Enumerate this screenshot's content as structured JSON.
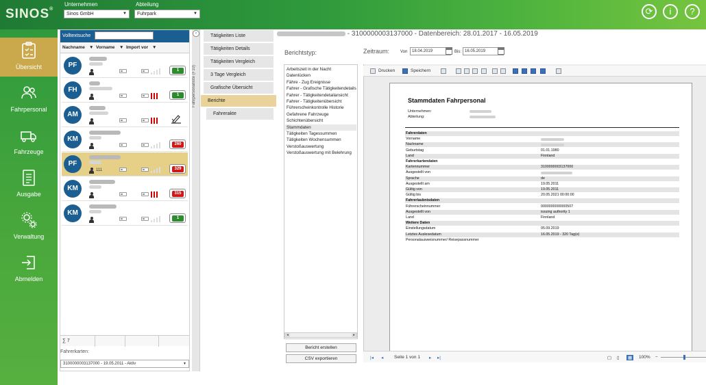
{
  "app": {
    "logo": "SINOS",
    "logo_mark": "®"
  },
  "header": {
    "company_label": "Unternehmen",
    "company_value": "Sinos GmbH",
    "department_label": "Abteilung",
    "department_value": "Fuhrpark",
    "icons": [
      "sync-icon",
      "info-icon",
      "help-icon"
    ],
    "info_glyph": "i",
    "help_glyph": "?",
    "sync_glyph": "⟳"
  },
  "sidenav": {
    "items": [
      {
        "label": "Übersicht",
        "icon": "checklist-icon",
        "active": true
      },
      {
        "label": "Fahrpersonal",
        "icon": "people-icon",
        "active": false
      },
      {
        "label": "Fahrzeuge",
        "icon": "truck-icon",
        "active": false
      },
      {
        "label": "Ausgabe",
        "icon": "document-icon",
        "active": false
      },
      {
        "label": "Verwaltung",
        "icon": "gears-icon",
        "active": false
      },
      {
        "label": "Abmelden",
        "icon": "logout-icon",
        "active": false
      }
    ]
  },
  "driver_list": {
    "search_label": "Volltextsuche",
    "columns": [
      "Nachname",
      "Vorname",
      "Import vor"
    ],
    "filter_glyph": "▼",
    "rows": [
      {
        "initials": "PF",
        "extra": "",
        "selected": false,
        "badge": "1",
        "badge_color": "#2e8b2e",
        "red_bars": false,
        "signature": false
      },
      {
        "initials": "FH",
        "extra": "",
        "selected": false,
        "badge": "1",
        "badge_color": "#2e8b2e",
        "red_bars": true,
        "signature": false
      },
      {
        "initials": "AM",
        "extra": "",
        "selected": false,
        "badge": "",
        "badge_color": "",
        "red_bars": true,
        "signature": true
      },
      {
        "initials": "KM",
        "extra": "",
        "selected": false,
        "badge": "260",
        "badge_color": "#d01818",
        "red_bars": false,
        "signature": false
      },
      {
        "initials": "PF",
        "extra": "111",
        "selected": true,
        "badge": "329",
        "badge_color": "#d01818",
        "red_bars": false,
        "signature": false
      },
      {
        "initials": "KM",
        "extra": "",
        "selected": false,
        "badge": "315",
        "badge_color": "#d01818",
        "red_bars": true,
        "signature": false
      },
      {
        "initials": "KM",
        "extra": "",
        "selected": false,
        "badge": "1",
        "badge_color": "#2e8b2e",
        "red_bars": false,
        "signature": false
      }
    ],
    "footer_sum": "∑ 7",
    "driver_cards_label": "Fahrerkarten:",
    "driver_cards_value": "3100000003137000 - 19.05.2011 - Aktiv"
  },
  "vertical_tab": {
    "label": "Fahrpersonalliste (F10)",
    "collapse_glyph": "‹"
  },
  "menu": {
    "items": [
      {
        "label": "Tätigkeiten Liste",
        "level": "sub"
      },
      {
        "label": "Tätigkeiten Details",
        "level": "sub"
      },
      {
        "label": "Tätigkeiten Vergleich",
        "level": "sub"
      },
      {
        "label": "3 Tage Vergleich",
        "level": "sub"
      },
      {
        "label": "Grafische Übersicht",
        "level": "sub"
      },
      {
        "label": "Berichte",
        "level": "top"
      },
      {
        "label": "Fahrerakte",
        "level": "sub"
      }
    ]
  },
  "content": {
    "title_suffix": "3100000003137000 - Datenbereich: 28.01.2017 - 16.05.2019",
    "report_type_label": "Berichtstyp:",
    "period_label": "Zeitraum:",
    "from_label": "Von",
    "from_value": "18.04.2019",
    "to_label": "Bis:",
    "to_value": "16.05.2019",
    "report_types": [
      "Arbeitszeit in der Nacht",
      "Datenlücken",
      "Fähre - Zug Ereignisse",
      "Fahrer - Grafische Tätigkeitendetails",
      "Fahrer - Tätigkeitendetailansicht",
      "Fahrer - Tätigkeitenübersicht",
      "Führerscheinkontrolle Historie",
      "Gefahrene Fahrzeuge",
      "Schichtenübersicht",
      "Stammdaten",
      "Tätigkeiten Tagessummen",
      "Tätigkeiten Wochensummen",
      "Verstoßauswertung",
      "Verstoßauswertung mit Belehrung"
    ],
    "selected_report_index": 9,
    "create_report_button": "Bericht erstellen",
    "csv_export_button": "CSV exportieren"
  },
  "viewer": {
    "print_label": "Drucken",
    "save_label": "Speichern",
    "page_status": "Seite 1 von 1",
    "zoom": "100%",
    "report": {
      "title": "Stammdaten Fahrpersonal",
      "company_label": "Unternehmen:",
      "department_label": "Abteilung:",
      "rows": [
        {
          "k": "Fahrerdaten",
          "v": "",
          "section": true,
          "blur": false
        },
        {
          "k": "Vorname",
          "v": "",
          "section": false,
          "blur": true
        },
        {
          "k": "Nachname",
          "v": "",
          "section": false,
          "blur": true
        },
        {
          "k": "Geburtstag",
          "v": "01.01.1980",
          "section": false,
          "blur": false
        },
        {
          "k": "Land",
          "v": "Finnland",
          "section": false,
          "blur": false
        },
        {
          "k": "Fahrerkartendaten",
          "v": "",
          "section": true,
          "blur": false
        },
        {
          "k": "Kartennummer",
          "v": "3100000003137000",
          "section": false,
          "blur": false
        },
        {
          "k": "Ausgestellt von",
          "v": "",
          "section": false,
          "blur": true
        },
        {
          "k": "Sprache",
          "v": "de",
          "section": false,
          "blur": false
        },
        {
          "k": "Ausgestellt am",
          "v": "19.05.2011",
          "section": false,
          "blur": false
        },
        {
          "k": "Gültig von",
          "v": "19.05.2011",
          "section": false,
          "blur": false
        },
        {
          "k": "Gültig bis",
          "v": "20.05.2021 00:00:00",
          "section": false,
          "blur": false
        },
        {
          "k": "Fahrerlaubnisdaten",
          "v": "",
          "section": true,
          "blur": false
        },
        {
          "k": "Führerscheinnummer",
          "v": "0000000000000507",
          "section": false,
          "blur": false
        },
        {
          "k": "Ausgestellt von",
          "v": "issuing authority 1",
          "section": false,
          "blur": false
        },
        {
          "k": "Land",
          "v": "Finnland",
          "section": false,
          "blur": false
        },
        {
          "k": "Weitere Daten",
          "v": "",
          "section": true,
          "blur": false
        },
        {
          "k": "Einstellungsdatum",
          "v": "05.09.2019",
          "section": false,
          "blur": false
        },
        {
          "k": "Letztes Auslesedatum",
          "v": "16.05.2019 - 320 Tag(e)",
          "section": false,
          "blur": false
        },
        {
          "k": "Personalausweisnummer/ Reisepassnummer",
          "v": "",
          "section": false,
          "blur": false
        }
      ]
    }
  }
}
